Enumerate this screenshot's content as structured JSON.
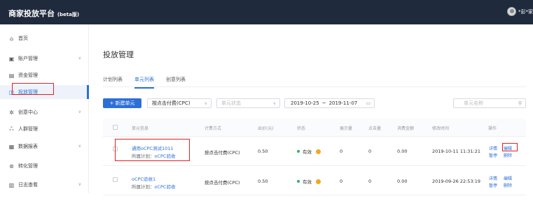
{
  "topbar": {
    "brand": "商家投放平台",
    "beta": "(beta版)",
    "user": "*彭*家"
  },
  "sidebar": {
    "items": [
      {
        "icon": "home-icon",
        "glyph": "⌂",
        "label": "首页",
        "chevron": false
      },
      {
        "icon": "account-icon",
        "glyph": "▣",
        "label": "账户管理",
        "chevron": true
      },
      {
        "icon": "funds-icon",
        "glyph": "▤",
        "label": "资金管理",
        "chevron": false
      },
      {
        "icon": "delivery-icon",
        "glyph": "◫",
        "label": "投放管理",
        "chevron": false,
        "active": true
      },
      {
        "icon": "creative-icon",
        "glyph": "✲",
        "label": "创意中心",
        "chevron": true
      },
      {
        "icon": "audience-icon",
        "glyph": "ஃ",
        "label": "人群管理",
        "chevron": false
      },
      {
        "icon": "report-icon",
        "glyph": "▦",
        "label": "数据报表",
        "chevron": true
      },
      {
        "icon": "conversion-icon",
        "glyph": "⊛",
        "label": "转化管理",
        "chevron": false
      },
      {
        "icon": "log-icon",
        "glyph": "▥",
        "label": "日志查看",
        "chevron": true
      }
    ]
  },
  "main": {
    "title": "投放管理",
    "tabs": [
      {
        "label": "计划列表",
        "active": false
      },
      {
        "label": "单元列表",
        "active": true
      },
      {
        "label": "创意列表",
        "active": false
      }
    ],
    "toolbar": {
      "new_button": "+ 新建单元",
      "billing_select": "按点击付费(CPC)",
      "status_placeholder": "单元状态",
      "date_from": "2019-10-25",
      "date_sep": "~",
      "date_to": "2019-11-07",
      "search_placeholder": "单元名称"
    },
    "table": {
      "headers": [
        "单元信息",
        "计费方式",
        "出价(元)",
        "状态",
        "展示量",
        "点击量",
        "消费金额",
        "修改时间",
        "操作"
      ],
      "rows": [
        {
          "name": "通用oCPC测试1011",
          "plan_prefix": "所属计划：",
          "plan": "oCPC验收",
          "billing": "按点击付费(CPC)",
          "bid": "0.50",
          "status": "有效",
          "impressions": "0",
          "clicks": "0",
          "cost": "0.00",
          "modified": "2019-10-11 11:31:21",
          "actions": [
            "详情",
            "编辑",
            "暂停",
            "删除"
          ]
        },
        {
          "name": "oCPC验收1",
          "plan_prefix": "所属计划：",
          "plan": "oCPC验收",
          "billing": "按点击付费(CPC)",
          "bid": "0.50",
          "status": "有效",
          "impressions": "0",
          "clicks": "0",
          "cost": "0.00",
          "modified": "2019-09-26 22:53:19",
          "actions": [
            "详情",
            "编辑",
            "暂停",
            "删除"
          ]
        }
      ]
    }
  },
  "colors": {
    "topbar": "#1f2a3c",
    "accent": "#2c6fd6",
    "highlight_box": "#e02020",
    "status_ok": "#2db36b",
    "warning": "#f0a820"
  }
}
